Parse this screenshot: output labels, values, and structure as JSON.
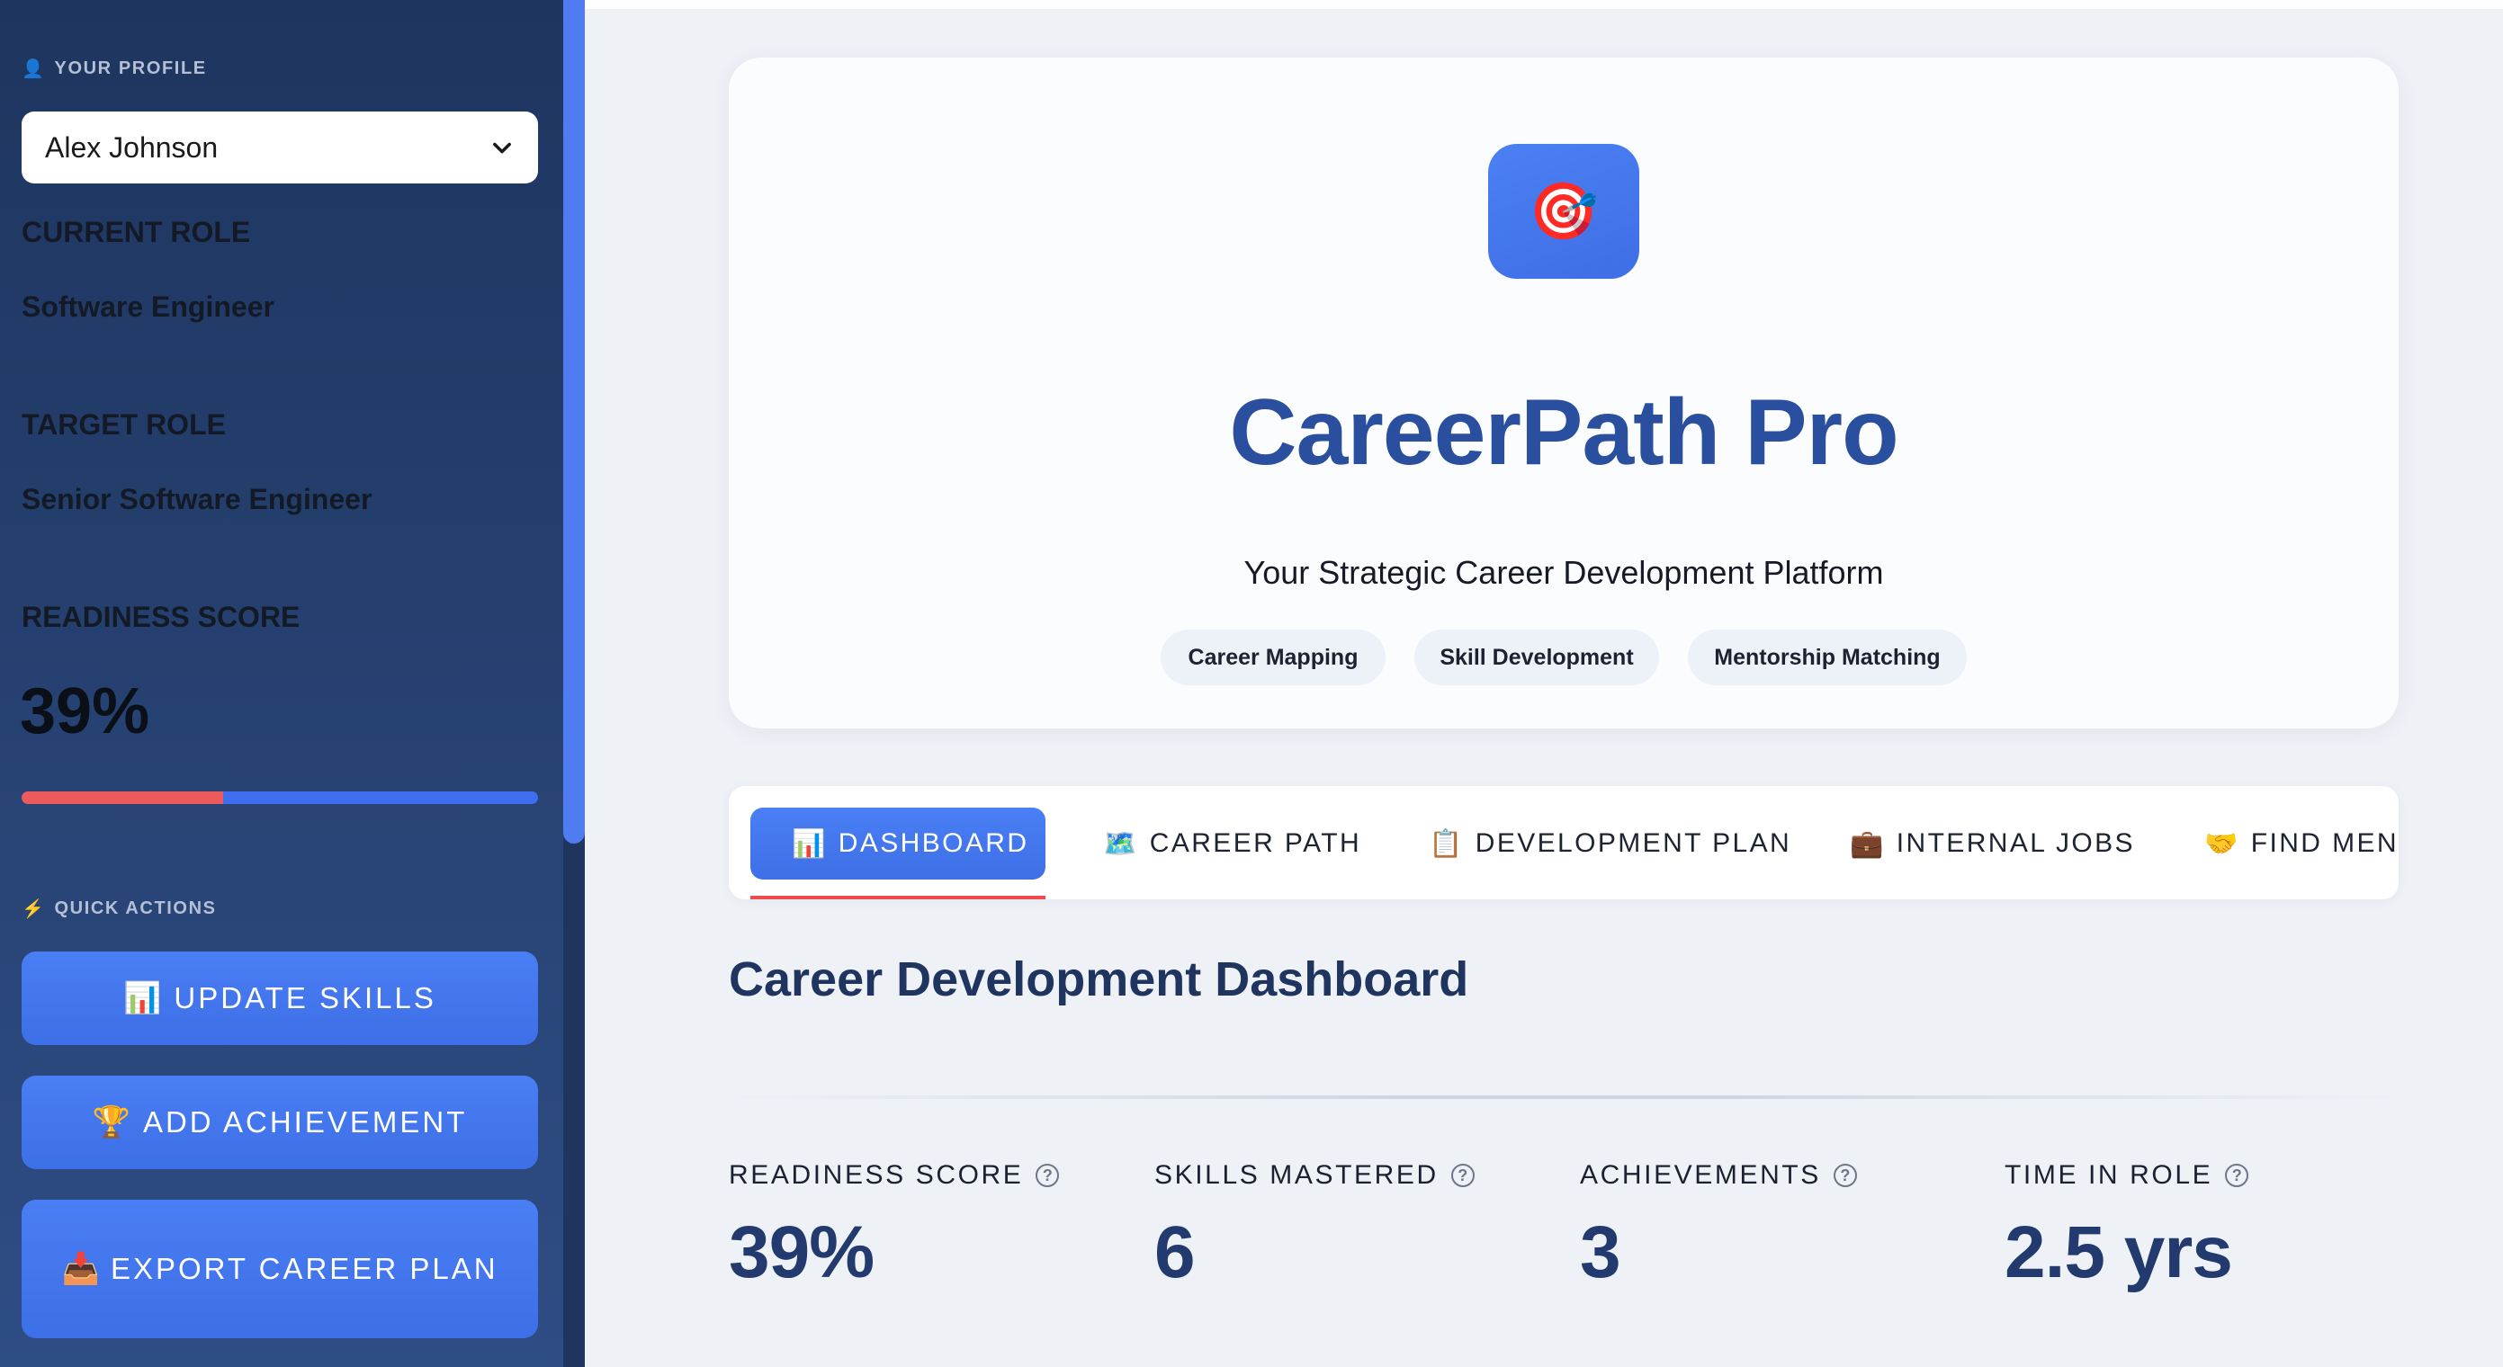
{
  "sidebar": {
    "profile_heading": "YOUR PROFILE",
    "profile_icon": "👤",
    "selected_profile": "Alex Johnson",
    "current_role_label": "CURRENT ROLE",
    "current_role": "Software Engineer",
    "target_role_label": "TARGET ROLE",
    "target_role": "Senior Software Engineer",
    "readiness_label": "READINESS SCORE",
    "readiness_score": "39%",
    "readiness_fraction": 0.39,
    "quick_actions_heading": "QUICK ACTIONS",
    "quick_actions_icon": "⚡",
    "actions": [
      {
        "icon": "📊",
        "label": "UPDATE SKILLS"
      },
      {
        "icon": "🏆",
        "label": "ADD ACHIEVEMENT"
      },
      {
        "icon": "📥",
        "label": "EXPORT CAREER PLAN"
      }
    ]
  },
  "hero": {
    "logo_icon": "🎯",
    "title": "CareerPath Pro",
    "subtitle": "Your Strategic Career Development Platform",
    "tags": [
      "Career Mapping",
      "Skill Development",
      "Mentorship Matching"
    ]
  },
  "tabs": [
    {
      "icon": "📊",
      "label": "DASHBOARD",
      "active": true
    },
    {
      "icon": "🗺️",
      "label": "CAREER PATH"
    },
    {
      "icon": "📋",
      "label": "DEVELOPMENT PLAN"
    },
    {
      "icon": "💼",
      "label": "INTERNAL JOBS"
    },
    {
      "icon": "🤝",
      "label": "FIND MENTORS"
    }
  ],
  "dashboard": {
    "title": "Career Development Dashboard",
    "metrics": [
      {
        "label": "READINESS SCORE",
        "value": "39%"
      },
      {
        "label": "SKILLS MASTERED",
        "value": "6"
      },
      {
        "label": "ACHIEVEMENTS",
        "value": "3"
      },
      {
        "label": "TIME IN ROLE",
        "value": "2.5 yrs"
      }
    ]
  },
  "colors": {
    "accent": "#3f72ea",
    "sidebar_bg": "#1e355f",
    "title_blue": "#2a4f9f",
    "progress_red": "#ec5b5b"
  }
}
